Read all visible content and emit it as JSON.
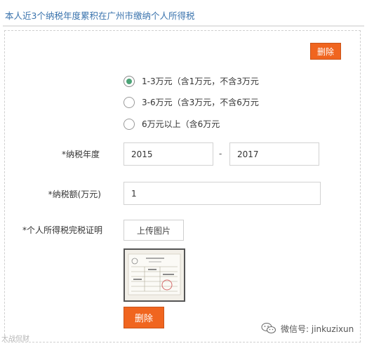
{
  "header": {
    "title": "本人近3个纳税年度累积在广州市缴纳个人所得税"
  },
  "buttons": {
    "delete_top": "删除",
    "delete_bottom": "删除",
    "upload": "上传图片"
  },
  "radios": [
    {
      "label": "1-3万元（含1万元，不含3万元",
      "checked": true
    },
    {
      "label": "3-6万元（含3万元，不含6万元",
      "checked": false
    },
    {
      "label": "6万元以上（含6万元",
      "checked": false
    }
  ],
  "fields": {
    "tax_year_label": "*纳税年度",
    "year_from": "2015",
    "year_separator": "-",
    "year_to": "2017",
    "tax_amount_label": "*纳税额(万元)",
    "tax_amount": "1",
    "certificate_label": "*个人所得税完税证明"
  },
  "watermarks": {
    "left": "大战侃财",
    "right": "微信号: jinkuzixun"
  },
  "colors": {
    "accent": "#f0651f",
    "title_blue": "#3a73ad",
    "radio_green": "#4ca377"
  }
}
